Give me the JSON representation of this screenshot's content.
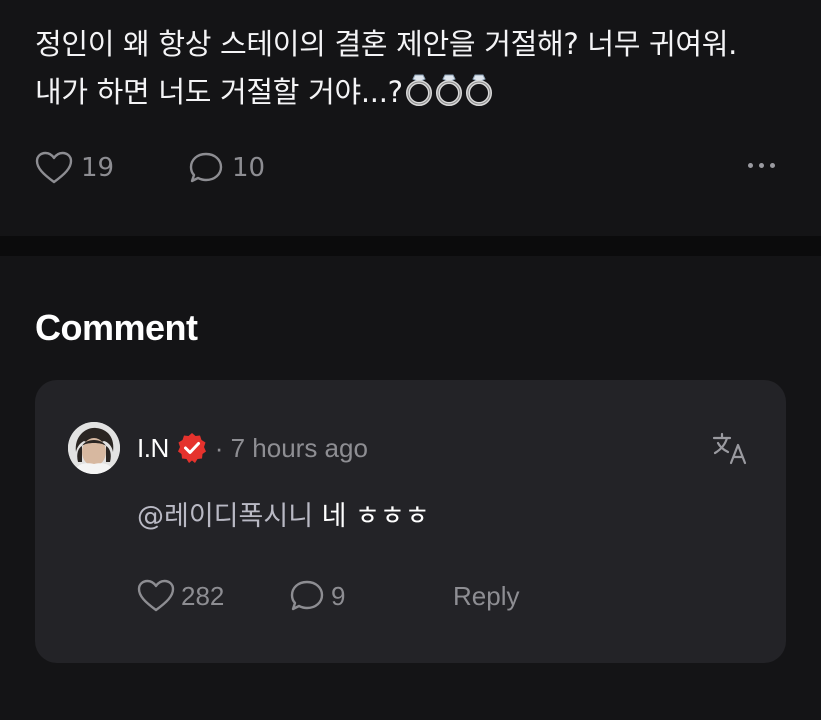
{
  "post": {
    "text_line1": "정인이 왜 항상 스테이의 결혼 제안을 거절해? 너무 귀여워.",
    "text_line2": "내가 하면 너도 거절할 거야...?",
    "emoji": "ring-emoji",
    "emoji_count": 3,
    "likes": "19",
    "comments": "10"
  },
  "comment_section": {
    "title": "Comment"
  },
  "comment": {
    "author": "I.N",
    "verified": true,
    "meta": "· 7 hours ago",
    "mention": "@레이디폭시니",
    "body": " 네 ㅎㅎㅎ",
    "likes": "282",
    "replies": "9",
    "reply_label": "Reply"
  },
  "colors": {
    "background": "#141416",
    "card": "#232327",
    "muted": "#8e8e93",
    "verified_badge": "#e5322d"
  },
  "icons": [
    "heart-icon",
    "comment-bubble-icon",
    "more-dots-icon",
    "verified-badge-icon",
    "translate-icon",
    "ring-emoji"
  ]
}
